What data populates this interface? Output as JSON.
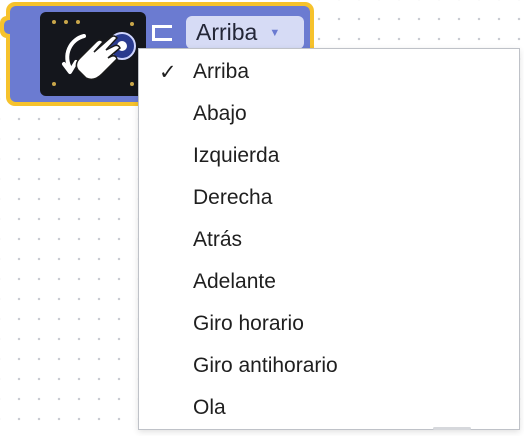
{
  "block": {
    "sensor_icon": "gesture-sensor-hand-icon",
    "connector_icon": "connector-lines-icon",
    "dropdown": {
      "value": "Arriba",
      "arrow_icon": "triangle-down-icon"
    },
    "colors": {
      "outline": "#f6c22c",
      "body": "#6b7bd1",
      "field": "#d6dbf5"
    }
  },
  "menu": {
    "selected_index": 0,
    "check_glyph": "✓",
    "items": [
      {
        "label": "Arriba"
      },
      {
        "label": "Abajo"
      },
      {
        "label": "Izquierda"
      },
      {
        "label": "Derecha"
      },
      {
        "label": "Atrás"
      },
      {
        "label": "Adelante"
      },
      {
        "label": "Giro horario"
      },
      {
        "label": "Giro antihorario"
      },
      {
        "label": "Ola"
      }
    ]
  }
}
